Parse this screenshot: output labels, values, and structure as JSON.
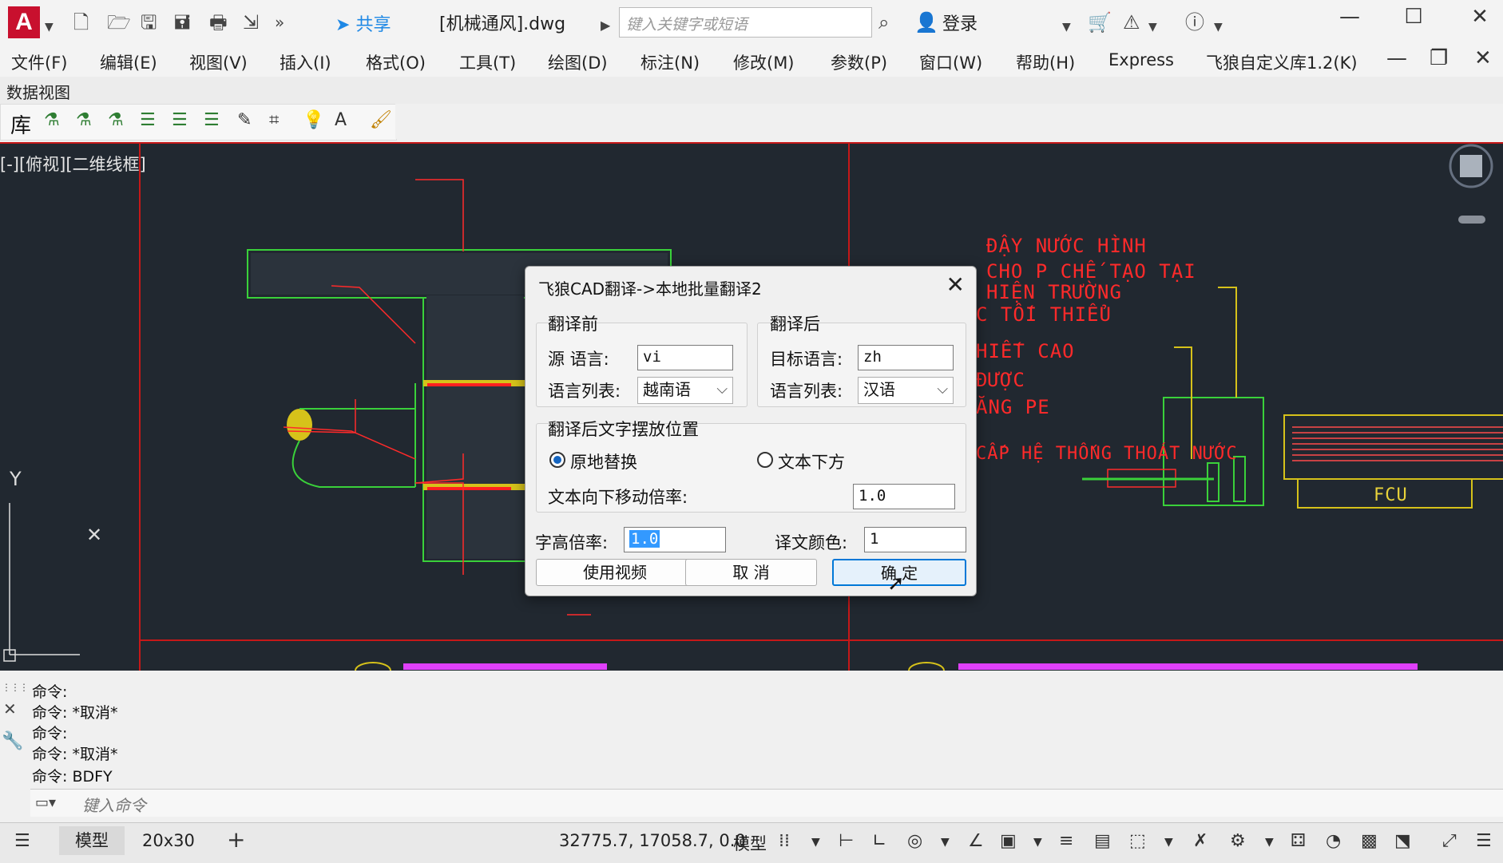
{
  "titlebar": {
    "logo": "A",
    "share_label": "共享",
    "doc_title": "[机械通风].dwg",
    "search_placeholder": "键入关键字或短语",
    "login_label": "登录",
    "icons": [
      "new-icon",
      "open-icon",
      "save-icon",
      "saveas-icon",
      "plot-icon",
      "share-icon",
      "more-icon"
    ]
  },
  "menubar": {
    "items": [
      "文件(F)",
      "编辑(E)",
      "视图(V)",
      "插入(I)",
      "格式(O)",
      "工具(T)",
      "绘图(D)",
      "标注(N)",
      "修改(M)",
      "参数(P)",
      "窗口(W)",
      "帮助(H)",
      "Express",
      "飞狼自定义库1.2(K)"
    ]
  },
  "dataview_label": "数据视图",
  "toolbar": {
    "library_label": "库"
  },
  "viewport": {
    "label": "[-][俯视][二维线框]",
    "cad_texts": [
      "ĐẬY NƯỚC HÌNH",
      "CHO P CHẾ TẠO TẠI",
      "HIỆN TRƯỜNG",
      "C TỐI THIỂU",
      "HIẾT CAO",
      "ĐƯỢC",
      "ĂNG PE",
      "CẤP HỆ THỐNG THOÁT NƯỚC",
      "FCU"
    ]
  },
  "dialog": {
    "title": "飞狼CAD翻译->本地批量翻译2",
    "before_group": "翻译前",
    "after_group": "翻译后",
    "source_lang_label": "源  语言:",
    "source_lang_value": "vi",
    "source_list_label": "语言列表:",
    "source_list_value": "越南语",
    "target_lang_label": "目标语言:",
    "target_lang_value": "zh",
    "target_list_label": "语言列表:",
    "target_list_value": "汉语",
    "position_group": "翻译后文字摆放位置",
    "radio_inplace": "原地替换",
    "radio_below": "文本下方",
    "offset_label": "文本向下移动倍率:",
    "offset_value": "1.0",
    "height_label": "字高倍率:",
    "height_value": "1.0",
    "color_label": "译文颜色:",
    "color_value": "1",
    "btn_video": "使用视频",
    "btn_cancel": "取  消",
    "btn_ok": "确  定"
  },
  "command": {
    "lines": [
      "命令:",
      "命令: *取消*",
      "命令:",
      "命令: *取消*",
      "命令: BDFY"
    ],
    "placeholder": "键入命令"
  },
  "statusbar": {
    "tab_model": "模型",
    "tab_layout": "20x30",
    "coords": "32775.7, 17058.7, 0.0",
    "model_label": "模型"
  }
}
